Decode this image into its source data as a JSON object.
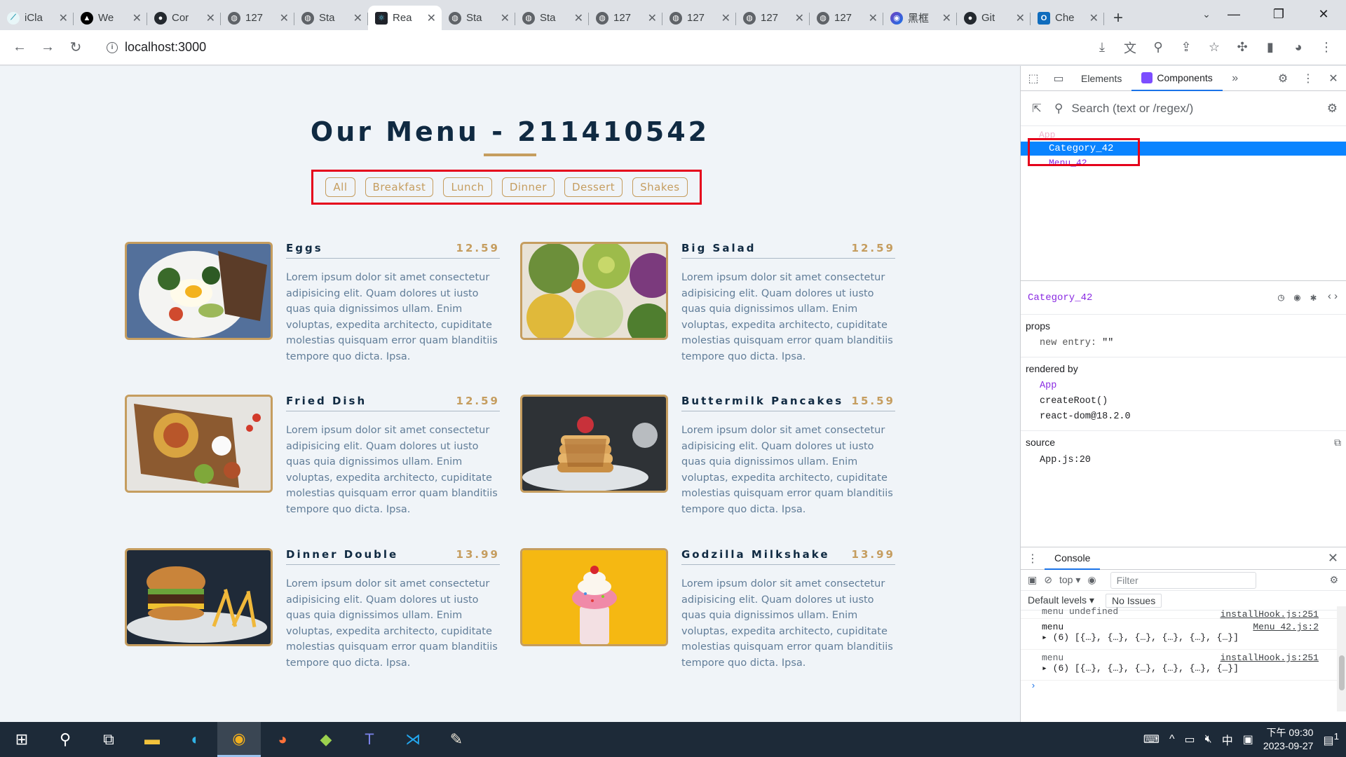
{
  "browser": {
    "tabs": [
      {
        "title": "iCla",
        "icon": "kite-icon",
        "color": "#2b9eb3"
      },
      {
        "title": "We",
        "icon": "vercel-icon",
        "color": "#000000"
      },
      {
        "title": "Cor",
        "icon": "github-icon",
        "color": "#24292f"
      },
      {
        "title": "127",
        "icon": "globe-icon",
        "color": "#5f6368"
      },
      {
        "title": "Sta",
        "icon": "globe-icon",
        "color": "#5f6368"
      },
      {
        "title": "Rea",
        "icon": "react-icon",
        "color": "#20232a",
        "active": true
      },
      {
        "title": "Sta",
        "icon": "globe-icon",
        "color": "#5f6368"
      },
      {
        "title": "Sta",
        "icon": "globe-icon",
        "color": "#5f6368"
      },
      {
        "title": "127",
        "icon": "globe-icon",
        "color": "#5f6368"
      },
      {
        "title": "127",
        "icon": "globe-icon",
        "color": "#5f6368"
      },
      {
        "title": "127",
        "icon": "globe-icon",
        "color": "#5f6368"
      },
      {
        "title": "127",
        "icon": "globe-icon",
        "color": "#5f6368"
      },
      {
        "title": "黑框",
        "icon": "copilot-icon",
        "color": "#6f42c1"
      },
      {
        "title": "Git",
        "icon": "github-icon",
        "color": "#24292f"
      },
      {
        "title": "Che",
        "icon": "outlook-icon",
        "color": "#0f6cbd"
      }
    ],
    "url": "localhost:3000"
  },
  "page": {
    "title": "Our Menu - 211410542",
    "categories": [
      "All",
      "Breakfast",
      "Lunch",
      "Dinner",
      "Dessert",
      "Shakes"
    ],
    "items": [
      {
        "name": "Eggs",
        "price": "12.59",
        "desc": "Lorem ipsum dolor sit amet consectetur adipisicing elit. Quam dolores ut iusto quas quia dignissimos ullam. Enim voluptas, expedita architecto, cupiditate molestias quisquam error quam blanditiis tempore quo dicta. Ipsa."
      },
      {
        "name": "Big Salad",
        "price": "12.59",
        "desc": "Lorem ipsum dolor sit amet consectetur adipisicing elit. Quam dolores ut iusto quas quia dignissimos ullam. Enim voluptas, expedita architecto, cupiditate molestias quisquam error quam blanditiis tempore quo dicta. Ipsa."
      },
      {
        "name": "Fried Dish",
        "price": "12.59",
        "desc": "Lorem ipsum dolor sit amet consectetur adipisicing elit. Quam dolores ut iusto quas quia dignissimos ullam. Enim voluptas, expedita architecto, cupiditate molestias quisquam error quam blanditiis tempore quo dicta. Ipsa."
      },
      {
        "name": "Buttermilk Pancakes",
        "price": "15.59",
        "desc": "Lorem ipsum dolor sit amet consectetur adipisicing elit. Quam dolores ut iusto quas quia dignissimos ullam. Enim voluptas, expedita architecto, cupiditate molestias quisquam error quam blanditiis tempore quo dicta. Ipsa."
      },
      {
        "name": "Dinner Double",
        "price": "13.99",
        "desc": "Lorem ipsum dolor sit amet consectetur adipisicing elit. Quam dolores ut iusto quas quia dignissimos ullam. Enim voluptas, expedita architecto, cupiditate molestias quisquam error quam blanditiis tempore quo dicta. Ipsa."
      },
      {
        "name": "Godzilla Milkshake",
        "price": "13.99",
        "desc": "Lorem ipsum dolor sit amet consectetur adipisicing elit. Quam dolores ut iusto quas quia dignissimos ullam. Enim voluptas, expedita architecto, cupiditate molestias quisquam error quam blanditiis tempore quo dicta. Ipsa."
      }
    ]
  },
  "devtools": {
    "tabs": {
      "elements": "Elements",
      "components": "Components",
      "more": "»"
    },
    "search_placeholder": "Search (text or /regex/)",
    "tree": {
      "app": "App",
      "category": "Category_42",
      "menu": "Menu_42"
    },
    "selected_component": "Category_42",
    "props": {
      "heading": "props",
      "key": "new entry",
      "value": "\"\""
    },
    "rendered_by": {
      "heading": "rendered by",
      "items": [
        "App",
        "createRoot()",
        "react-dom@18.2.0"
      ]
    },
    "source": {
      "heading": "source",
      "value": "App.js:20"
    },
    "console": {
      "tab": "Console",
      "context": "top",
      "filter_placeholder": "Filter",
      "levels": "Default levels",
      "issues": "No Issues",
      "logs": [
        {
          "label": "menu undefined",
          "src": "installHook.js:251",
          "value": ""
        },
        {
          "label": "menu",
          "src": "Menu_42.js:2",
          "value": "(6) [{…}, {…}, {…}, {…}, {…}, {…}]"
        },
        {
          "label": "menu",
          "src": "installHook.js:251",
          "value": "(6) [{…}, {…}, {…}, {…}, {…}, {…}]"
        }
      ]
    }
  },
  "taskbar": {
    "tray": {
      "ime": "中",
      "time": "下午 09:30",
      "date": "2023-09-27",
      "notifications": "1"
    }
  },
  "colors": {
    "accent": "#c59d5f",
    "title": "#102a42",
    "highlight": "#e5001b",
    "selection": "#0a84ff"
  }
}
